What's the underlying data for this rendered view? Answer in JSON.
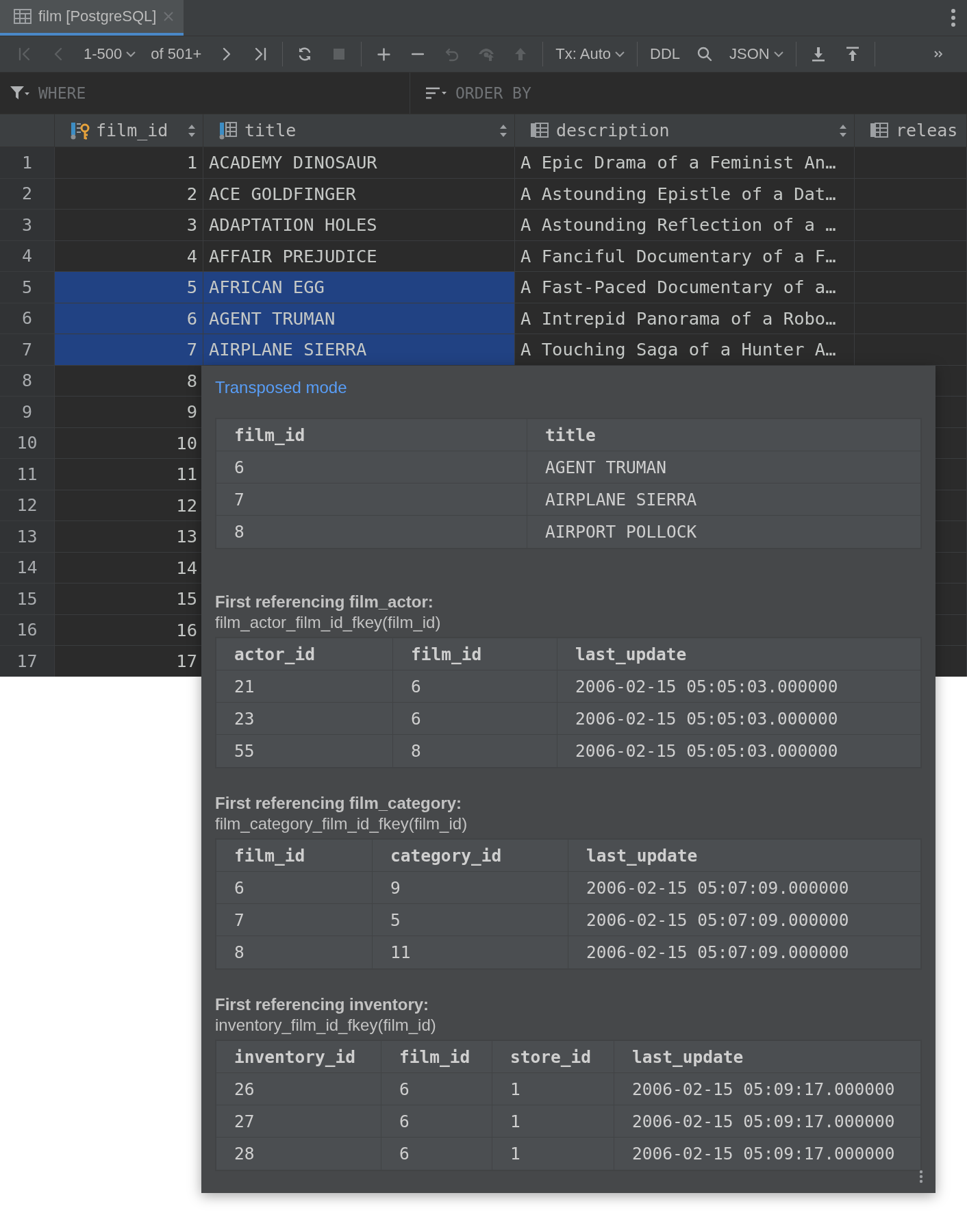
{
  "tabs": [
    {
      "label": "film [PostgreSQL]",
      "selected": true
    }
  ],
  "toolbar": [
    [
      {
        "kind": "first",
        "disabled": true
      },
      {
        "kind": "prev",
        "disabled": true
      },
      {
        "kind": "dropdown",
        "label": "1-500"
      },
      {
        "kind": "label",
        "label": "of 501+"
      },
      {
        "kind": "next",
        "disabled": false
      },
      {
        "kind": "last",
        "disabled": false
      }
    ],
    [
      {
        "kind": "refresh",
        "disabled": false
      },
      {
        "kind": "stop",
        "disabled": true
      }
    ],
    [
      {
        "kind": "add",
        "disabled": false
      },
      {
        "kind": "remove",
        "disabled": false
      },
      {
        "kind": "revert",
        "disabled": true
      },
      {
        "kind": "preview",
        "disabled": true
      },
      {
        "kind": "submit",
        "disabled": true
      }
    ],
    [
      {
        "kind": "dropdown",
        "label": "Tx: Auto"
      }
    ],
    [
      {
        "kind": "label",
        "label": "DDL"
      },
      {
        "kind": "search",
        "disabled": false
      },
      {
        "kind": "dropdown",
        "label": "JSON"
      }
    ],
    [
      {
        "kind": "download",
        "disabled": false
      },
      {
        "kind": "upload",
        "disabled": false
      }
    ],
    [
      {
        "kind": "more",
        "disabled": false
      }
    ]
  ],
  "filter": {
    "where": {
      "placeholder": "WHERE"
    },
    "order_by": {
      "placeholder": "ORDER BY"
    }
  },
  "grid": {
    "columns": [
      {
        "name": "film_id",
        "kind": "key",
        "sortable": true
      },
      {
        "name": "title",
        "kind": "required",
        "sortable": true
      },
      {
        "name": "description",
        "kind": "plain",
        "sortable": true
      },
      {
        "name": "releas",
        "kind": "plain",
        "sortable": false
      }
    ],
    "rows": [
      {
        "number": "1",
        "cells": [
          {
            "text": "1",
            "selected": false
          },
          {
            "text": "ACADEMY DINOSAUR",
            "selected": false
          },
          {
            "text": "A Epic Drama of a Feminist An…",
            "selected": false
          }
        ]
      },
      {
        "number": "2",
        "cells": [
          {
            "text": "2",
            "selected": false
          },
          {
            "text": "ACE GOLDFINGER",
            "selected": false
          },
          {
            "text": "A Astounding Epistle of a Dat…",
            "selected": false
          }
        ]
      },
      {
        "number": "3",
        "cells": [
          {
            "text": "3",
            "selected": false
          },
          {
            "text": "ADAPTATION HOLES",
            "selected": false
          },
          {
            "text": "A Astounding Reflection of a …",
            "selected": false
          }
        ]
      },
      {
        "number": "4",
        "cells": [
          {
            "text": "4",
            "selected": false
          },
          {
            "text": "AFFAIR PREJUDICE",
            "selected": false
          },
          {
            "text": "A Fanciful Documentary of a F…",
            "selected": false
          }
        ]
      },
      {
        "number": "5",
        "cells": [
          {
            "text": "5",
            "selected": true
          },
          {
            "text": "AFRICAN EGG",
            "selected": true
          },
          {
            "text": "A Fast-Paced Documentary of a…",
            "selected": false
          }
        ]
      },
      {
        "number": "6",
        "cells": [
          {
            "text": "6",
            "selected": true
          },
          {
            "text": "AGENT TRUMAN",
            "selected": true
          },
          {
            "text": "A Intrepid Panorama of a Robo…",
            "selected": false
          }
        ]
      },
      {
        "number": "7",
        "cells": [
          {
            "text": "7",
            "selected": true
          },
          {
            "text": "AIRPLANE SIERRA",
            "selected": true
          },
          {
            "text": "A Touching Saga of a Hunter A…",
            "selected": false
          }
        ]
      },
      {
        "number": "8",
        "cells": [
          {
            "text": "8",
            "selected": false
          }
        ]
      },
      {
        "number": "9",
        "cells": [
          {
            "text": "9",
            "selected": false
          }
        ]
      },
      {
        "number": "10",
        "cells": [
          {
            "text": "10",
            "selected": false
          }
        ]
      },
      {
        "number": "11",
        "cells": [
          {
            "text": "11",
            "selected": false
          }
        ]
      },
      {
        "number": "12",
        "cells": [
          {
            "text": "12",
            "selected": false
          }
        ]
      },
      {
        "number": "13",
        "cells": [
          {
            "text": "13",
            "selected": false
          }
        ]
      },
      {
        "number": "14",
        "cells": [
          {
            "text": "14",
            "selected": false
          }
        ]
      },
      {
        "number": "15",
        "cells": [
          {
            "text": "15",
            "selected": false
          }
        ]
      },
      {
        "number": "16",
        "cells": [
          {
            "text": "16",
            "selected": false
          }
        ]
      },
      {
        "number": "17",
        "cells": [
          {
            "text": "17",
            "selected": false
          }
        ]
      }
    ]
  },
  "popup": {
    "link": "Transposed mode",
    "sections": [
      {
        "columns": [
          "film_id",
          "title"
        ],
        "rows": [
          [
            "6",
            "AGENT TRUMAN"
          ],
          [
            "7",
            "AIRPLANE SIERRA"
          ],
          [
            "8",
            "AIRPORT POLLOCK"
          ]
        ]
      },
      {
        "heading": "First referencing film_actor:",
        "constraint": "film_actor_film_id_fkey(film_id)",
        "columns": [
          "actor_id",
          "film_id",
          "last_update"
        ],
        "rows": [
          [
            "21",
            "6",
            "2006-02-15 05:05:03.000000"
          ],
          [
            "23",
            "6",
            "2006-02-15 05:05:03.000000"
          ],
          [
            "55",
            "8",
            "2006-02-15 05:05:03.000000"
          ]
        ]
      },
      {
        "heading": "First referencing film_category:",
        "constraint": "film_category_film_id_fkey(film_id)",
        "columns": [
          "film_id",
          "category_id",
          "last_update"
        ],
        "rows": [
          [
            "6",
            "9",
            "2006-02-15 05:07:09.000000"
          ],
          [
            "7",
            "5",
            "2006-02-15 05:07:09.000000"
          ],
          [
            "8",
            "11",
            "2006-02-15 05:07:09.000000"
          ]
        ]
      },
      {
        "heading": "First referencing inventory:",
        "constraint": "inventory_film_id_fkey(film_id)",
        "columns": [
          "inventory_id",
          "film_id",
          "store_id",
          "last_update"
        ],
        "rows": [
          [
            "26",
            "6",
            "1",
            "2006-02-15 05:09:17.000000"
          ],
          [
            "27",
            "6",
            "1",
            "2006-02-15 05:09:17.000000"
          ],
          [
            "28",
            "6",
            "1",
            "2006-02-15 05:09:17.000000"
          ]
        ]
      }
    ]
  }
}
